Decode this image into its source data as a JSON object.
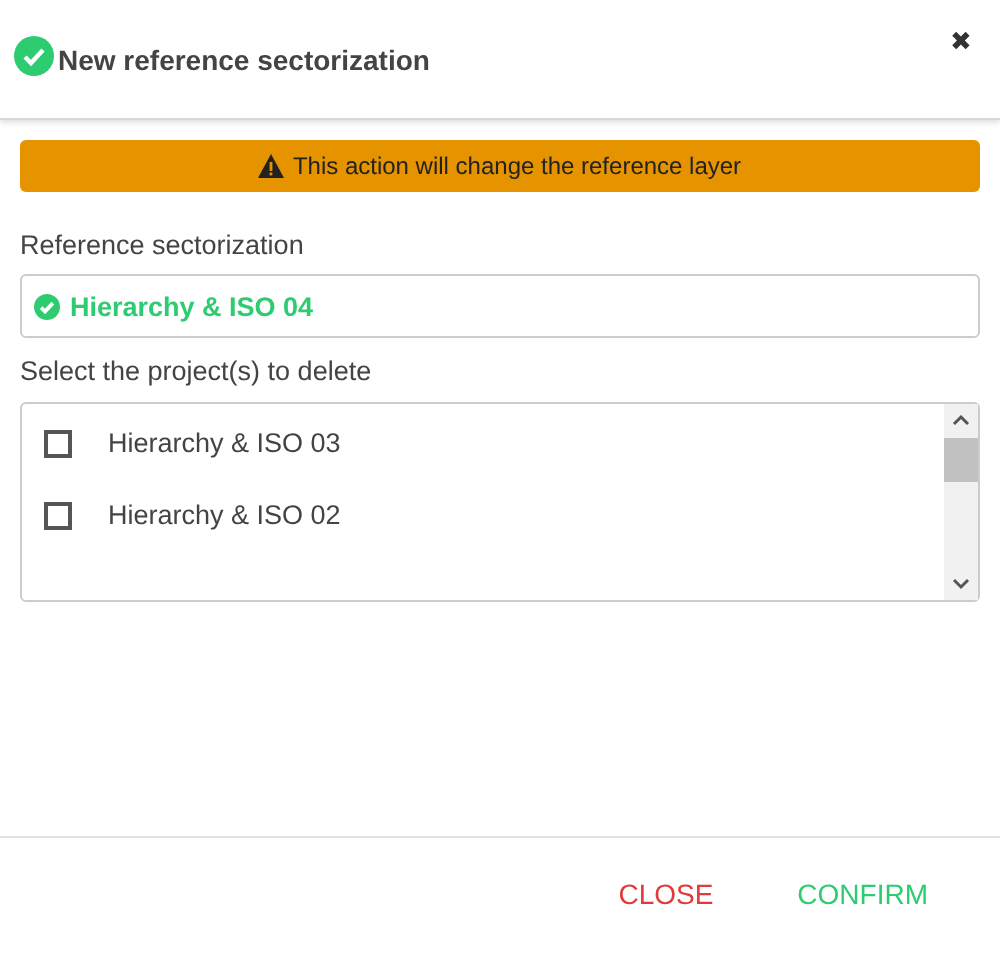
{
  "dialog": {
    "title": "New reference sectorization",
    "close": "✖"
  },
  "warning": {
    "text": "This action will change the reference layer"
  },
  "reference": {
    "label": "Reference sectorization",
    "value": "Hierarchy & ISO 04"
  },
  "projects": {
    "label": "Select the project(s) to delete",
    "items": [
      {
        "label": "Hierarchy & ISO 03",
        "checked": false
      },
      {
        "label": "Hierarchy & ISO 02",
        "checked": false
      }
    ]
  },
  "buttons": [
    {
      "label": "CLOSE",
      "kind": "cancel"
    },
    {
      "label": "CONFIRM",
      "kind": "confirm"
    }
  ]
}
